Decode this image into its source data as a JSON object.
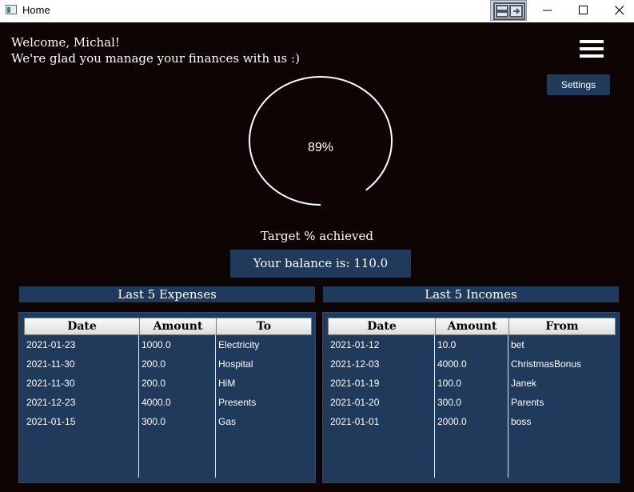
{
  "window": {
    "title": "Home"
  },
  "header": {
    "welcome_line1": "Welcome, Michal!",
    "welcome_line2": "We're glad you manage your finances with us :)",
    "menu_icon": "hamburger-menu-icon",
    "settings_label": "Settings"
  },
  "progress": {
    "percent_label": "89%",
    "value": 0.89,
    "target_label": "Target % achieved"
  },
  "balance": {
    "label": "Your balance is: 110.0"
  },
  "expenses": {
    "title": "Last 5 Expenses",
    "columns": [
      "Date",
      "Amount",
      "To"
    ],
    "rows": [
      [
        "2021-01-23",
        "1000.0",
        "Electricity"
      ],
      [
        "2021-11-30",
        "200.0",
        "Hospital"
      ],
      [
        "2021-11-30",
        "200.0",
        "HiM"
      ],
      [
        "2021-12-23",
        "4000.0",
        "Presents"
      ],
      [
        "2021-01-15",
        "300.0",
        "Gas"
      ]
    ]
  },
  "incomes": {
    "title": "Last 5 Incomes",
    "columns": [
      "Date",
      "Amount",
      "From"
    ],
    "rows": [
      [
        "2021-01-12",
        "10.0",
        "bet"
      ],
      [
        "2021-12-03",
        "4000.0",
        "ChristmasBonus"
      ],
      [
        "2021-01-19",
        "100.0",
        "Janek"
      ],
      [
        "2021-01-20",
        "300.0",
        "Parents"
      ],
      [
        "2021-01-01",
        "2000.0",
        "boss"
      ]
    ]
  },
  "colors": {
    "background": "#0e0404",
    "accent": "#1f3a5a",
    "text": "#ffffff"
  }
}
